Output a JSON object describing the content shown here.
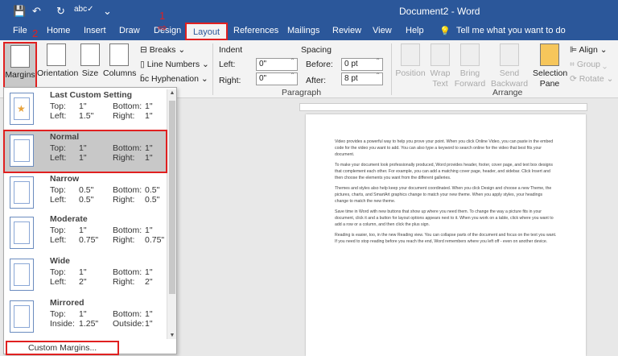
{
  "window": {
    "title": "Document2 - Word"
  },
  "qat": {
    "save": "💾",
    "undo": "↶",
    "redo": "↻",
    "spell": "abc✓",
    "more": "⌄"
  },
  "tabs": [
    "File",
    "Home",
    "Insert",
    "Draw",
    "Design",
    "Layout",
    "References",
    "Mailings",
    "Review",
    "View",
    "Help"
  ],
  "tell_me": "Tell me what you want to do",
  "ribbon": {
    "margins": "Margins",
    "orientation": "Orientation",
    "size": "Size",
    "columns": "Columns",
    "breaks": "Breaks",
    "line_numbers": "Line Numbers",
    "hyphenation": "Hyphenation",
    "indent": "Indent",
    "left": "Left:",
    "right": "Right:",
    "left_val": "0\"",
    "right_val": "0\"",
    "spacing": "Spacing",
    "before": "Before:",
    "after": "After:",
    "before_val": "0 pt",
    "after_val": "8 pt",
    "paragraph": "Paragraph",
    "position": "Position",
    "wrap_text": "Wrap Text",
    "bring_forward": "Bring Forward",
    "send_backward": "Send Backward",
    "selection_pane": "Selection Pane",
    "align": "Align",
    "group": "Group",
    "rotate": "Rotate",
    "arrange": "Arrange"
  },
  "annotations": {
    "step1": "1",
    "step2": "2"
  },
  "margins_menu": {
    "items": [
      {
        "name": "Last Custom Setting",
        "r1": [
          "Top:",
          "1\"",
          "Bottom:",
          "1\""
        ],
        "r2": [
          "Left:",
          "1.5\"",
          "Right:",
          "1\""
        ]
      },
      {
        "name": "Normal",
        "r1": [
          "Top:",
          "1\"",
          "Bottom:",
          "1\""
        ],
        "r2": [
          "Left:",
          "1\"",
          "Right:",
          "1\""
        ]
      },
      {
        "name": "Narrow",
        "r1": [
          "Top:",
          "0.5\"",
          "Bottom:",
          "0.5\""
        ],
        "r2": [
          "Left:",
          "0.5\"",
          "Right:",
          "0.5\""
        ]
      },
      {
        "name": "Moderate",
        "r1": [
          "Top:",
          "1\"",
          "Bottom:",
          "1\""
        ],
        "r2": [
          "Left:",
          "0.75\"",
          "Right:",
          "0.75\""
        ]
      },
      {
        "name": "Wide",
        "r1": [
          "Top:",
          "1\"",
          "Bottom:",
          "1\""
        ],
        "r2": [
          "Left:",
          "2\"",
          "Right:",
          "2\""
        ]
      },
      {
        "name": "Mirrored",
        "r1": [
          "Top:",
          "1\"",
          "Bottom:",
          "1\""
        ],
        "r2": [
          "Inside:",
          "1.25\"",
          "Outside:",
          "1\""
        ]
      }
    ],
    "custom": "Custom Margins..."
  },
  "document": {
    "paragraphs": [
      "Video provides a powerful way to help you prove your point. When you click Online Video, you can paste in the embed code for the video you want to add. You can also type a keyword to search online for the video that best fits your document.",
      "To make your document look professionally produced, Word provides header, footer, cover page, and text box designs that complement each other. For example, you can add a matching cover page, header, and sidebar. Click Insert and then choose the elements you want from the different galleries.",
      "Themes and styles also help keep your document coordinated. When you click Design and choose a new Theme, the pictures, charts, and SmartArt graphics change to match your new theme. When you apply styles, your headings change to match the new theme.",
      "Save time in Word with new buttons that show up where you need them. To change the way a picture fits in your document, click it and a button for layout options appears next to it. When you work on a table, click where you want to add a row or a column, and then click the plus sign.",
      "Reading is easier, too, in the new Reading view. You can collapse parts of the document and focus on the text you want. If you need to stop reading before you reach the end, Word remembers where you left off - even on another device."
    ]
  }
}
